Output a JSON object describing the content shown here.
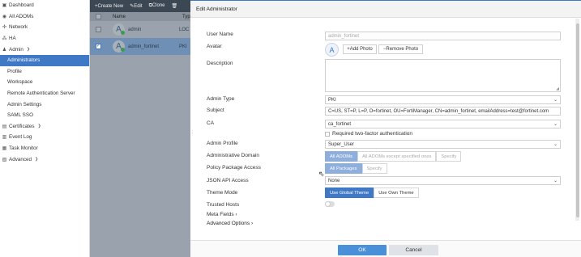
{
  "sidebar": {
    "items": [
      {
        "label": "Dashboard",
        "icon": "dashboard-icon",
        "glyph": "▣"
      },
      {
        "label": "All ADOMs",
        "icon": "globe-icon",
        "glyph": "◉"
      },
      {
        "label": "Network",
        "icon": "network-icon",
        "glyph": "✣"
      },
      {
        "label": "HA",
        "icon": "ha-icon",
        "glyph": "⁂"
      },
      {
        "label": "Admin",
        "icon": "user-icon",
        "glyph": "♟"
      },
      {
        "label": "Administrators"
      },
      {
        "label": "Profile"
      },
      {
        "label": "Workspace"
      },
      {
        "label": "Remote Authentication Server"
      },
      {
        "label": "Admin Settings"
      },
      {
        "label": "SAML SSO"
      },
      {
        "label": "Certificates",
        "icon": "certificate-icon",
        "glyph": "▤"
      },
      {
        "label": "Event Log",
        "icon": "log-icon",
        "glyph": "▥"
      },
      {
        "label": "Task Monitor",
        "icon": "monitor-icon",
        "glyph": "▦"
      },
      {
        "label": "Advanced",
        "icon": "advanced-icon",
        "glyph": "▧"
      }
    ]
  },
  "background": {
    "toolbar": {
      "create": "+Create New",
      "edit": "✎Edit",
      "clone": "⧉Clone",
      "delete": "🗑"
    },
    "header": {
      "name": "Name",
      "type": "Typ"
    },
    "rows": [
      {
        "initial": "A",
        "name": "admin",
        "type": "LOC"
      },
      {
        "initial": "A",
        "name": "admin_fortinet",
        "type": "PKI"
      }
    ]
  },
  "dialog": {
    "title": "Edit Administrator",
    "splitter": "⋮",
    "labels": {
      "user_name": "User Name",
      "avatar": "Avatar",
      "description": "Description",
      "admin_type": "Admin Type",
      "subject": "Subject",
      "ca": "CA",
      "admin_profile": "Admin Profile",
      "admin_domain": "Administrative Domain",
      "policy_package": "Policy Package Access",
      "json_api": "JSON API Access",
      "theme_mode": "Theme Mode",
      "trusted_hosts": "Trusted Hosts",
      "meta_fields": "Meta Fields",
      "advanced_options": "Advanced Options"
    },
    "values": {
      "user_name": "admin_fortinet",
      "avatar_initial": "A",
      "admin_type": "PKI",
      "subject": "C=US, ST=P, L=P, O=fortinet, OU=FortiManager, CN=admin_fortinet, emailAddress=test@fortinet.com",
      "ca": "ca_fortinet",
      "two_factor": "Required two-factor authentication",
      "admin_profile": "Super_User",
      "json_api": "None"
    },
    "buttons": {
      "add_photo": "Add Photo",
      "remove_photo": "Remove Photo",
      "ok": "OK",
      "cancel": "Cancel"
    },
    "admin_domain_options": [
      "All ADOMs",
      "All ADOMs except specified ones",
      "Specify"
    ],
    "policy_package_options": [
      "All Packages",
      "Specify"
    ],
    "theme_options": [
      "Use Global Theme",
      "Use Own Theme"
    ]
  }
}
